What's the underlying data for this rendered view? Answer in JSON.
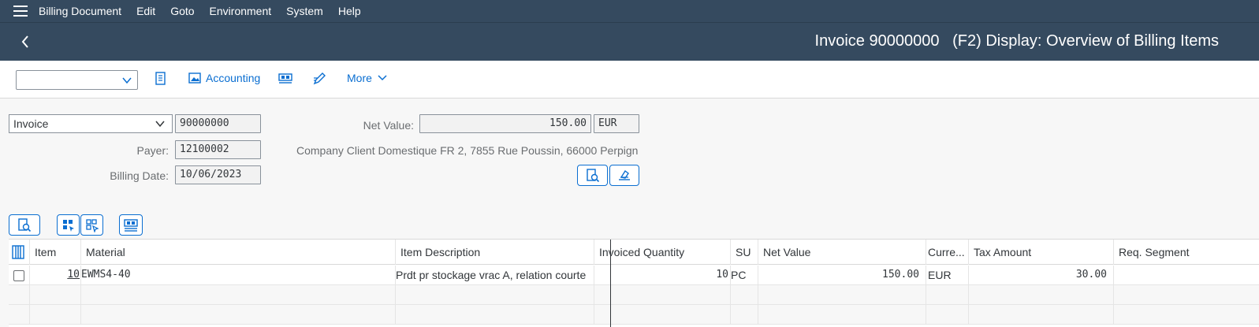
{
  "menu": {
    "items": [
      "Billing Document",
      "Edit",
      "Goto",
      "Environment",
      "System",
      "Help"
    ]
  },
  "title": {
    "text": "Invoice 90000000   (F2) Display: Overview of Billing Items"
  },
  "toolbar": {
    "select_value": "",
    "accounting_label": "Accounting",
    "more_label": "More"
  },
  "header": {
    "doc_type": "Invoice",
    "doc_number": "90000000",
    "payer_label": "Payer:",
    "payer": "12100002",
    "billing_date_label": "Billing Date:",
    "billing_date": "10/06/2023",
    "net_value_label": "Net Value:",
    "net_value": "150.00",
    "currency": "EUR",
    "payer_description": "Company Client Domestique FR 2, 7855 Rue Poussin, 66000 Perpign…"
  },
  "table": {
    "columns": [
      "Item",
      "Material",
      "Item Description",
      "Invoiced Quantity",
      "SU",
      "Net Value",
      "Curre...",
      "Tax Amount",
      "Req. Segment"
    ],
    "rows": [
      {
        "item": "10",
        "material": "EWMS4-40",
        "description": "Prdt pr stockage vrac A, relation courte",
        "quantity": "10",
        "su": "PC",
        "net_value": "150.00",
        "currency": "EUR",
        "tax_amount": "30.00",
        "req_segment": ""
      }
    ]
  },
  "colors": {
    "shell": "#354a5f",
    "accent": "#0a6ed1",
    "background": "#f7f7f7"
  }
}
